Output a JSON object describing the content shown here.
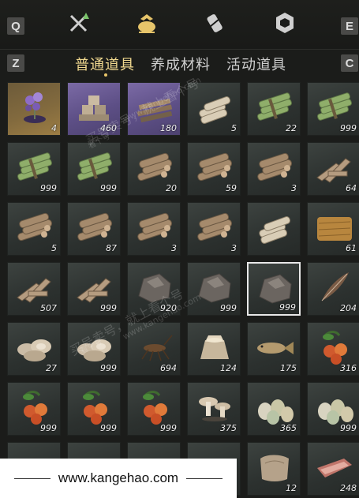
{
  "keys": {
    "q": "Q",
    "e": "E",
    "z": "Z",
    "c": "C"
  },
  "tabs": [
    "普通道具",
    "养成材料",
    "活动道具"
  ],
  "active_tab": 0,
  "items": [
    {
      "icon": "flower-icon",
      "count": "4",
      "bg": "gold"
    },
    {
      "icon": "stone-blocks-icon",
      "count": "460",
      "bg": "purple"
    },
    {
      "icon": "timber-pile-icon",
      "count": "180",
      "bg": "purple"
    },
    {
      "icon": "pale-logs-icon",
      "count": "5",
      "bg": "plain"
    },
    {
      "icon": "bamboo-bundle-icon",
      "count": "22",
      "bg": "plain"
    },
    {
      "icon": "bamboo-bundle-icon",
      "count": "999",
      "bg": "plain"
    },
    {
      "icon": "bamboo-bundle-icon",
      "count": "999",
      "bg": "plain"
    },
    {
      "icon": "bamboo-bundle-icon",
      "count": "999",
      "bg": "plain"
    },
    {
      "icon": "log-pile-icon",
      "count": "20",
      "bg": "plain"
    },
    {
      "icon": "log-pile-icon",
      "count": "59",
      "bg": "plain"
    },
    {
      "icon": "log-pile-icon",
      "count": "3",
      "bg": "plain"
    },
    {
      "icon": "firewood-icon",
      "count": "64",
      "bg": "plain"
    },
    {
      "icon": "log-pile-icon",
      "count": "5",
      "bg": "plain"
    },
    {
      "icon": "log-pile-icon",
      "count": "87",
      "bg": "plain"
    },
    {
      "icon": "log-pile-icon",
      "count": "3",
      "bg": "plain"
    },
    {
      "icon": "log-pile-icon",
      "count": "3",
      "bg": "plain"
    },
    {
      "icon": "pale-logs-icon",
      "count": "",
      "bg": "plain"
    },
    {
      "icon": "hay-bale-icon",
      "count": "61",
      "bg": "plain"
    },
    {
      "icon": "firewood-icon",
      "count": "507",
      "bg": "plain"
    },
    {
      "icon": "firewood-icon",
      "count": "999",
      "bg": "plain"
    },
    {
      "icon": "rock-icon",
      "count": "920",
      "bg": "plain"
    },
    {
      "icon": "rock-icon",
      "count": "999",
      "bg": "plain"
    },
    {
      "icon": "rock-icon",
      "count": "999",
      "bg": "plain"
    },
    {
      "icon": "feather-icon",
      "count": "204",
      "bg": "plain"
    },
    {
      "icon": "oyster-icon",
      "count": "27",
      "bg": "plain"
    },
    {
      "icon": "oyster-icon",
      "count": "999",
      "bg": "plain"
    },
    {
      "icon": "insect-icon",
      "count": "694",
      "bg": "plain"
    },
    {
      "icon": "grain-sack-icon",
      "count": "124",
      "bg": "plain"
    },
    {
      "icon": "fish-icon",
      "count": "175",
      "bg": "plain"
    },
    {
      "icon": "berries-icon",
      "count": "316",
      "bg": "plain"
    },
    {
      "icon": "berries-icon",
      "count": "999",
      "bg": "plain"
    },
    {
      "icon": "berries-icon",
      "count": "999",
      "bg": "plain"
    },
    {
      "icon": "berries-icon",
      "count": "999",
      "bg": "plain"
    },
    {
      "icon": "mushroom-icon",
      "count": "375",
      "bg": "plain"
    },
    {
      "icon": "eggs-icon",
      "count": "365",
      "bg": "plain"
    },
    {
      "icon": "eggs-icon",
      "count": "999",
      "bg": "plain"
    },
    {
      "icon": "meat-icon",
      "count": "",
      "bg": "plain"
    },
    {
      "icon": "meat-icon",
      "count": "",
      "bg": "plain"
    },
    {
      "icon": "meat-icon",
      "count": "",
      "bg": "plain"
    },
    {
      "icon": "meat-icon",
      "count": "",
      "bg": "plain"
    },
    {
      "icon": "hide-icon",
      "count": "12",
      "bg": "plain"
    },
    {
      "icon": "meat-icon",
      "count": "248",
      "bg": "plain"
    }
  ],
  "selected_index": 22,
  "watermarks": [
    "买号卖号，就上看个号",
    "www.kangehao.com",
    "看个号",
    "买号卖号，就上看个号",
    "www.kangehao.com",
    "看个号"
  ],
  "footer": {
    "url": "www.kangehao.com"
  }
}
